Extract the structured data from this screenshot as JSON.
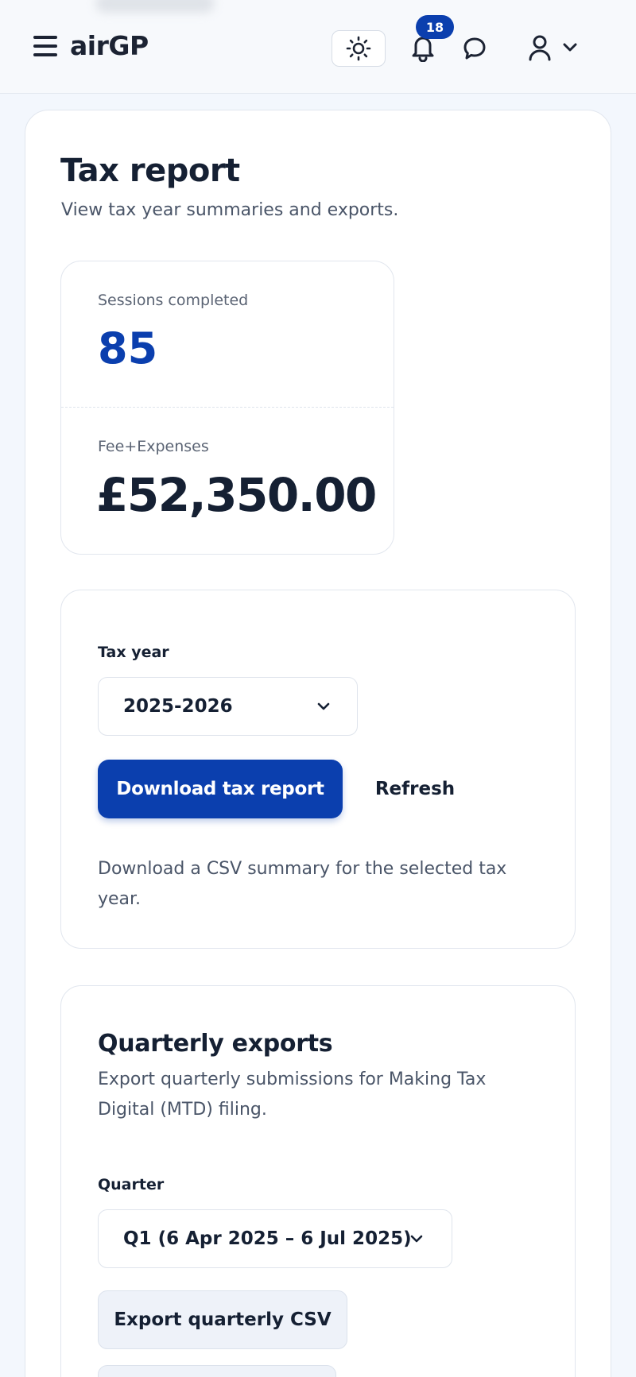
{
  "header": {
    "app_name": "airGP",
    "notification_count": "18",
    "icons": {
      "menu": "hamburger-menu-icon",
      "theme": "sun-icon",
      "notifications": "bell-icon",
      "messages": "chat-bubble-icon",
      "account": "user-icon",
      "account_menu": "chevron-down-icon"
    }
  },
  "page": {
    "title": "Tax report",
    "subtitle": "View tax year summaries and exports."
  },
  "stats": {
    "sessions_label": "Sessions completed",
    "sessions_value": "85",
    "fee_label": "Fee+Expenses",
    "fee_value": "£52,350.00"
  },
  "tax_year": {
    "label": "Tax year",
    "selected": "2025-2026",
    "download_button": "Download tax report",
    "refresh_button": "Refresh",
    "note": "Download a CSV summary for the selected tax year."
  },
  "quarterly": {
    "title": "Quarterly exports",
    "description": "Export quarterly submissions for Making Tax Digital (MTD) filing.",
    "quarter_label": "Quarter",
    "selected_quarter": "Q1 (6 Apr 2025 – 6 Jul 2025)",
    "export_button": "Export quarterly CSV"
  },
  "colors": {
    "accent": "#0b3fae",
    "background": "#f3f7fd",
    "text": "#152033"
  }
}
